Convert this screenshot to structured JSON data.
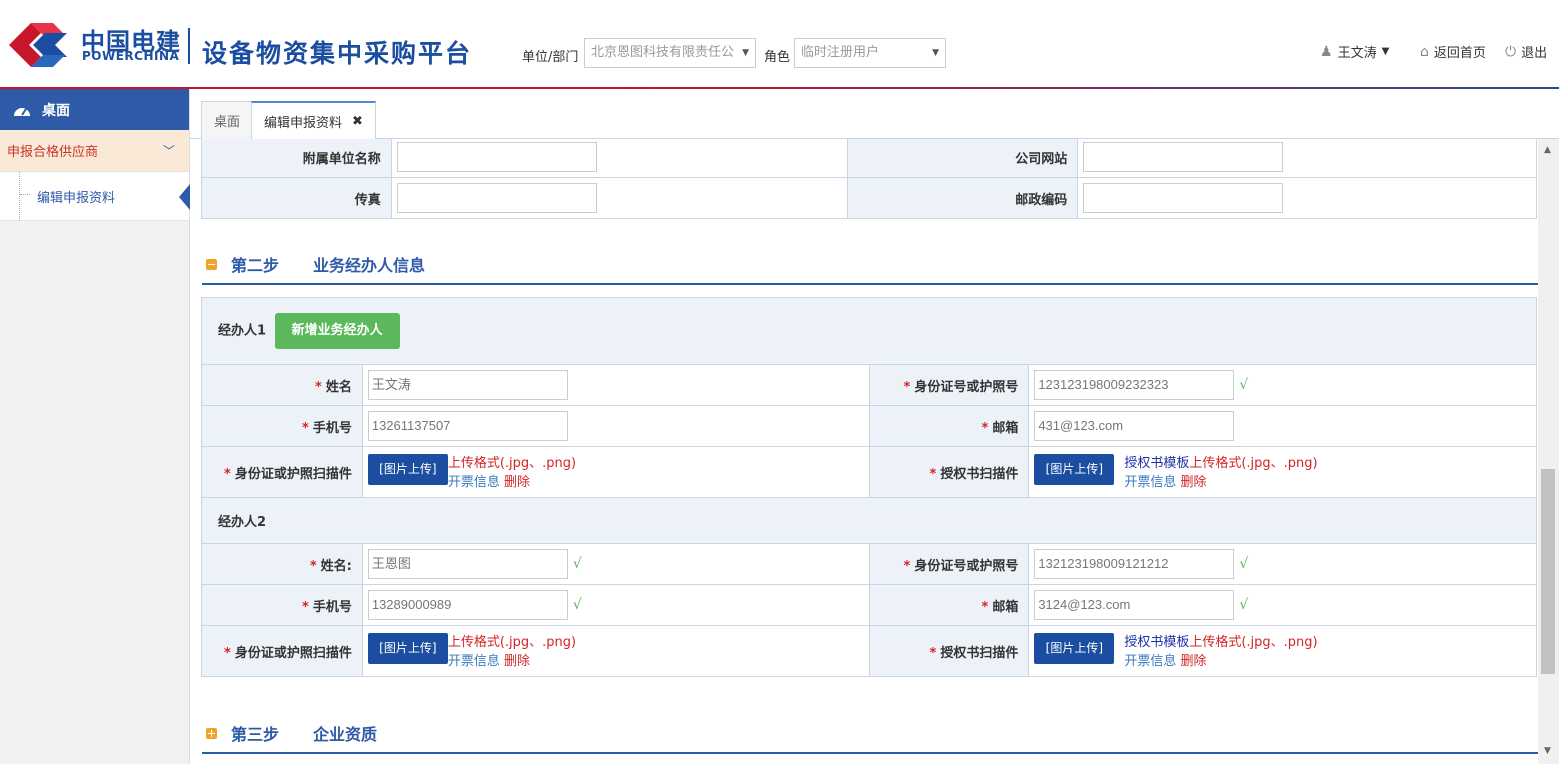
{
  "header": {
    "logo_cn": "中国电建",
    "logo_en": "POWERCHINA",
    "platform_title": "设备物资集中采购平台",
    "unit_label": "单位/部门",
    "unit_value": "北京恩图科技有限责任公",
    "role_label": "角色",
    "role_value": "临时注册用户",
    "user_name": "王文涛",
    "home_label": "返回首页",
    "logout_label": "退出"
  },
  "sidebar": {
    "desk": "桌面",
    "group": "申报合格供应商",
    "item": "编辑申报资料"
  },
  "tabs": [
    {
      "label": "桌面"
    },
    {
      "label": "编辑申报资料"
    }
  ],
  "step1_rows": {
    "affiliate_label": "附属单位名称",
    "website_label": "公司网站",
    "fax_label": "传真",
    "postcode_label": "邮政编码"
  },
  "step2": {
    "no": "第二步",
    "title": "业务经办人信息"
  },
  "step3": {
    "no": "第三步",
    "title": "企业资质"
  },
  "agent1": {
    "head": "经办人1",
    "add_button": "新增业务经办人",
    "name_label": "姓名",
    "name_value": "王文涛",
    "id_label": "身份证号或护照号",
    "id_value": "123123198009232323",
    "phone_label": "手机号",
    "phone_value": "13261137507",
    "email_label": "邮箱",
    "email_value": "431@123.com",
    "idscan_label": "身份证或护照扫描件",
    "auth_label": "授权书扫描件"
  },
  "agent2": {
    "head": "经办人2",
    "name_label": "姓名:",
    "name_value": "王恩图",
    "id_label": "身份证号或护照号",
    "id_value": "132123198009121212",
    "phone_label": "手机号",
    "phone_value": "13289000989",
    "email_label": "邮箱",
    "email_value": "3124@123.com",
    "idscan_label": "身份证或护照扫描件",
    "auth_label": "授权书扫描件"
  },
  "upload": {
    "button": "[图片上传]",
    "format": "上传格式(.jpg、.png)",
    "template": "授权书模板",
    "invoice": "开票信息",
    "delete": "删除"
  },
  "marks": {
    "required": "*",
    "check": "√"
  },
  "colors": {
    "brand_blue": "#1b4ea0",
    "brand_red": "#c8162b",
    "green_button": "#5cb85c",
    "label_bg": "#edf2f9"
  }
}
